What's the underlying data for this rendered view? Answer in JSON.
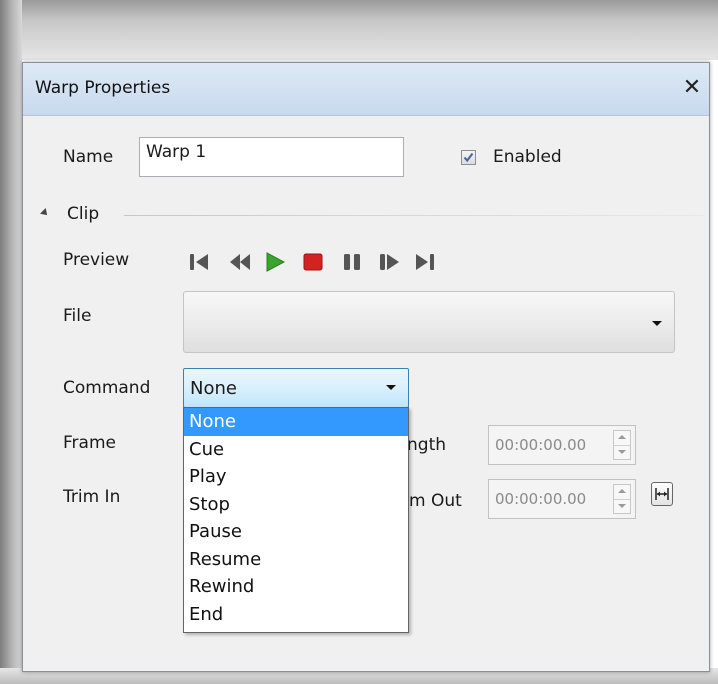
{
  "dialog": {
    "title": "Warp Properties",
    "close_label": "✕"
  },
  "name": {
    "label": "Name",
    "value": "Warp 1"
  },
  "enabled": {
    "label": "Enabled",
    "checked": true
  },
  "clip": {
    "section_label": "Clip",
    "preview_label": "Preview",
    "transport_icons": [
      "skip-to-start-icon",
      "rewind-icon",
      "play-icon",
      "stop-icon",
      "pause-icon",
      "step-forward-icon",
      "skip-to-end-icon"
    ],
    "file_label": "File",
    "file_value": "",
    "command_label": "Command",
    "command_value": "None",
    "command_options": [
      "None",
      "Cue",
      "Play",
      "Stop",
      "Pause",
      "Resume",
      "Rewind",
      "End"
    ],
    "frame_label": "Frame",
    "length_label_visible": "ngth",
    "length_value": "00:00:00.00",
    "trim_in_label": "Trim In",
    "trim_out_label_visible": "m Out",
    "trim_out_value": "00:00:00.00"
  },
  "colors": {
    "play": "#3aa52c",
    "stop": "#d32222",
    "selection": "#3399ff",
    "title_bar": "#d3e2f2"
  }
}
